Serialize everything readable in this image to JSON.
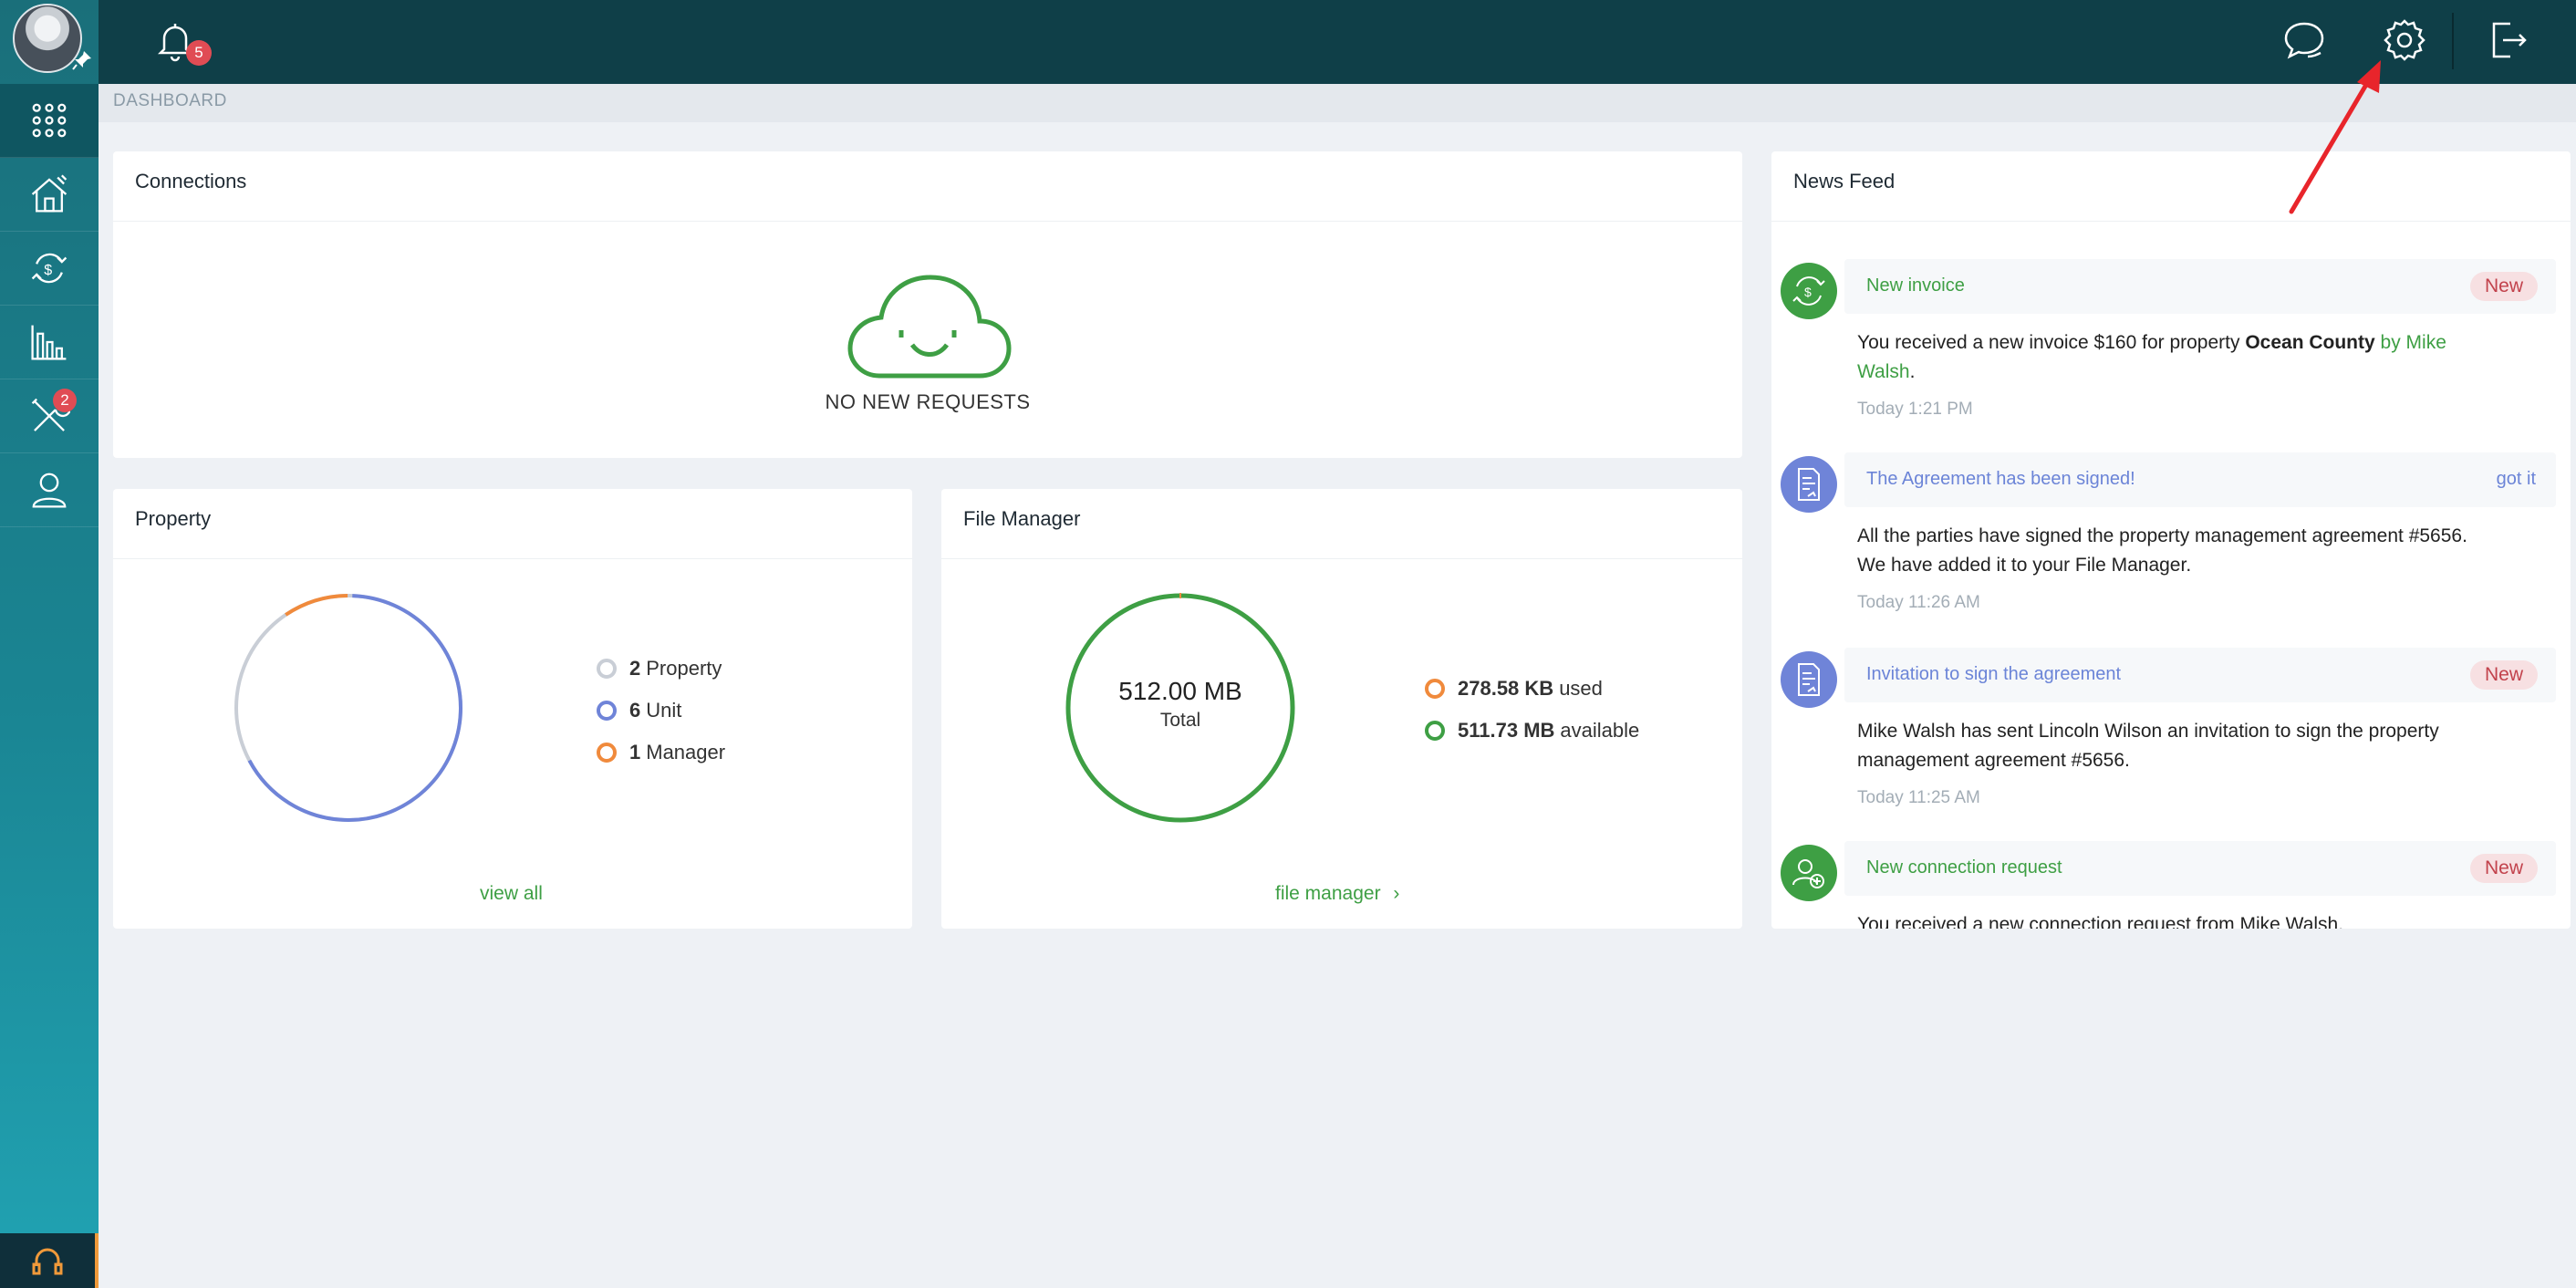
{
  "topbar": {
    "notification_count": "5"
  },
  "sidebar": {
    "items": [
      {
        "name": "apps"
      },
      {
        "name": "properties"
      },
      {
        "name": "payments"
      },
      {
        "name": "reports"
      },
      {
        "name": "maintenance",
        "badge": "2"
      },
      {
        "name": "profile"
      }
    ]
  },
  "breadcrumb": "DASHBOARD",
  "connections": {
    "title": "Connections",
    "empty_text": "NO NEW REQUESTS"
  },
  "property": {
    "title": "Property",
    "legend": [
      {
        "count": "2",
        "label": "Property",
        "color": "#c9ced6"
      },
      {
        "count": "6",
        "label": "Unit",
        "color": "#6f84d8"
      },
      {
        "count": "1",
        "label": "Manager",
        "color": "#f08a3c"
      }
    ],
    "link": "view all"
  },
  "file_manager": {
    "title": "File Manager",
    "total_value": "512.00 MB",
    "total_label": "Total",
    "legend": [
      {
        "value": "278.58 KB",
        "label": "used",
        "color": "#f08a3c"
      },
      {
        "value": "511.73 MB",
        "label": "available",
        "color": "#3e9f44"
      }
    ],
    "link": "file manager",
    "link_chevron": "›"
  },
  "news_feed": {
    "title": "News Feed",
    "items": [
      {
        "title": "New invoice",
        "tag": "New",
        "body_parts": [
          "You received a new invoice $160 for property ",
          "Ocean County",
          " by Mike",
          "Walsh",
          "."
        ],
        "time": "Today 1:21 PM",
        "icon": "invoice-icon"
      },
      {
        "title": "The Agreement has been signed!",
        "action": "got it",
        "body_lines": [
          "All the parties have signed the property management agreement #5656.",
          "We have added it to your File Manager."
        ],
        "time": "Today 11:26 AM",
        "icon": "agreement-icon"
      },
      {
        "title": "Invitation to sign the agreement",
        "tag": "New",
        "body_lines": [
          "Mike Walsh has sent Lincoln Wilson an invitation to sign the property",
          "management agreement #5656."
        ],
        "time": "Today 11:25 AM",
        "icon": "agreement-icon"
      },
      {
        "title": "New connection request",
        "tag": "New",
        "body_lines": [
          "You received a new connection request from Mike Walsh."
        ],
        "icon": "connection-icon"
      }
    ]
  },
  "colors": {
    "topbar": "#0f3f48",
    "accent_green": "#3e9f44",
    "accent_blue": "#6b84d7",
    "badge_red": "#e04c54"
  }
}
